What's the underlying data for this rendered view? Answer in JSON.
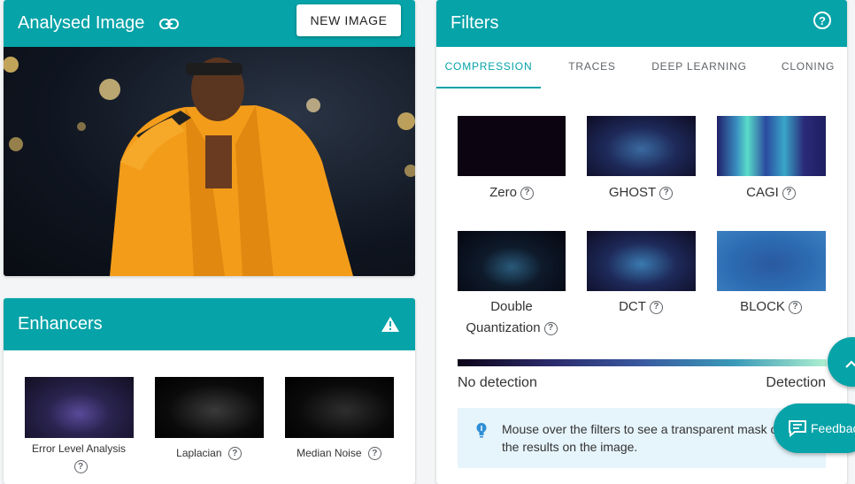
{
  "analysed": {
    "title": "Analysed Image",
    "link_icon": "link-icon",
    "new_image_label": "NEW IMAGE"
  },
  "enhancers": {
    "title": "Enhancers",
    "warning_icon": "warning-icon",
    "items": [
      {
        "label": "Error Level Analysis"
      },
      {
        "label": "Laplacian"
      },
      {
        "label": "Median Noise"
      }
    ]
  },
  "filters": {
    "title": "Filters",
    "help_icon": "help-circle-icon",
    "tabs": [
      {
        "label": "COMPRESSION",
        "active": true
      },
      {
        "label": "TRACES",
        "active": false
      },
      {
        "label": "DEEP LEARNING",
        "active": false
      },
      {
        "label": "CLONING",
        "active": false
      }
    ],
    "items": [
      {
        "label": "Zero"
      },
      {
        "label": "GHOST"
      },
      {
        "label": "CAGI"
      },
      {
        "label_line1": "Double",
        "label_line2": "Quantization"
      },
      {
        "label": "DCT"
      },
      {
        "label": "BLOCK"
      }
    ],
    "scale": {
      "low": "No detection",
      "high": "Detection"
    },
    "info": "Mouse over the filters to see a transparent mask of the results on the image.",
    "info_icon": "lightbulb-icon"
  },
  "fab": {
    "scroll_icon": "chevron-up-icon",
    "feedback_label": "Feedback",
    "feedback_icon": "feedback-icon"
  },
  "help_glyph": "?",
  "colors": {
    "brand": "#06a3a8",
    "info_bg": "#e6f4fb"
  }
}
